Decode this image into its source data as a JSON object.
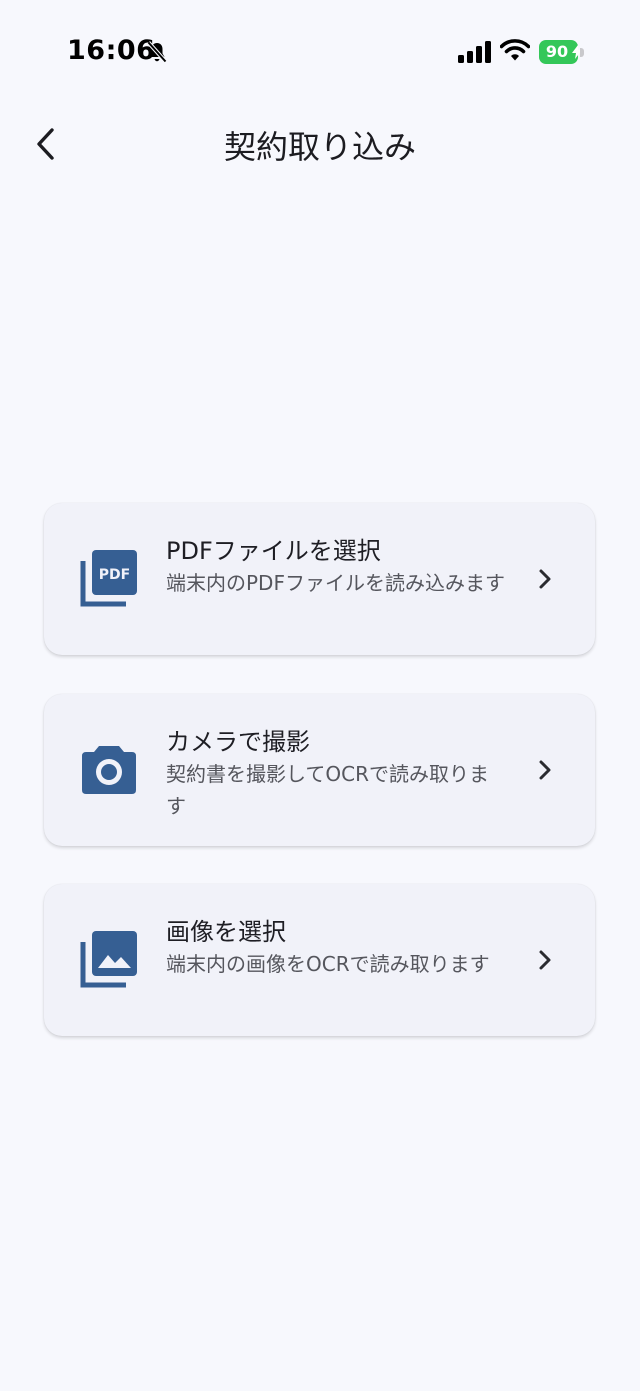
{
  "status_bar": {
    "time": "16:06",
    "battery_level": "90",
    "battery_color": "#34c759"
  },
  "nav": {
    "title": "契約取り込み",
    "back_icon": "chevron-left"
  },
  "accent_color": "#365f93",
  "options": [
    {
      "title": "PDFファイルを選択",
      "description": "端末内のPDFファイルを読み込みます",
      "icon": "pdf-file-icon"
    },
    {
      "title": "カメラで撮影",
      "description": "契約書を撮影してOCRで読み取ります",
      "icon": "camera-icon"
    },
    {
      "title": "画像を選択",
      "description": "端末内の画像をOCRで読み取ります",
      "icon": "image-library-icon"
    }
  ]
}
